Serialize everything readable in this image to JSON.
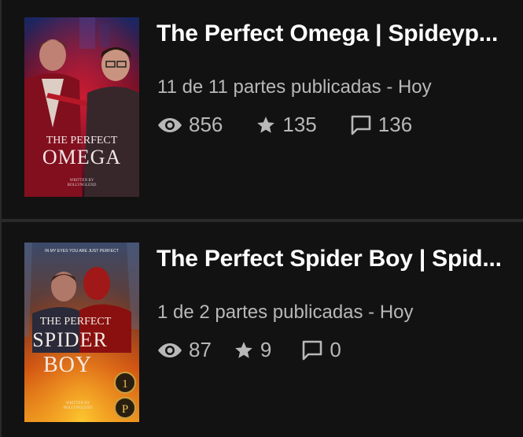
{
  "stories": [
    {
      "title": "The Perfect Omega | Spideyp...",
      "parts_text": "11 de 11 partes publicadas - Hoy",
      "reads": "856",
      "votes": "135",
      "comments": "136",
      "cover": {
        "title_line1": "THE PERFECT",
        "title_line2": "OMEGA",
        "credit_line1": "WRITTEN BY",
        "credit_line2": "BOLLYNGLEXD"
      }
    },
    {
      "title": "The Perfect Spider Boy | Spid...",
      "parts_text": "1 de 2 partes publicadas - Hoy",
      "reads": "87",
      "votes": "9",
      "comments": "0",
      "cover": {
        "tagline": "IN MY EYES YOU ARE JUST PERFECT",
        "title_line1": "THE PERFECT",
        "title_line2": "SPIDER",
        "title_line3": "BOY",
        "credit_line1": "WRITTEN BY",
        "credit_line2": "BOLLYNGLEXD",
        "badge1": "1",
        "badge2": "P"
      }
    }
  ],
  "icons": {
    "reads": "eye-icon",
    "votes": "star-icon",
    "comments": "comment-icon"
  },
  "colors": {
    "background": "#121212",
    "divider": "#2a2a2a",
    "meta_text": "#b8b8b8"
  }
}
